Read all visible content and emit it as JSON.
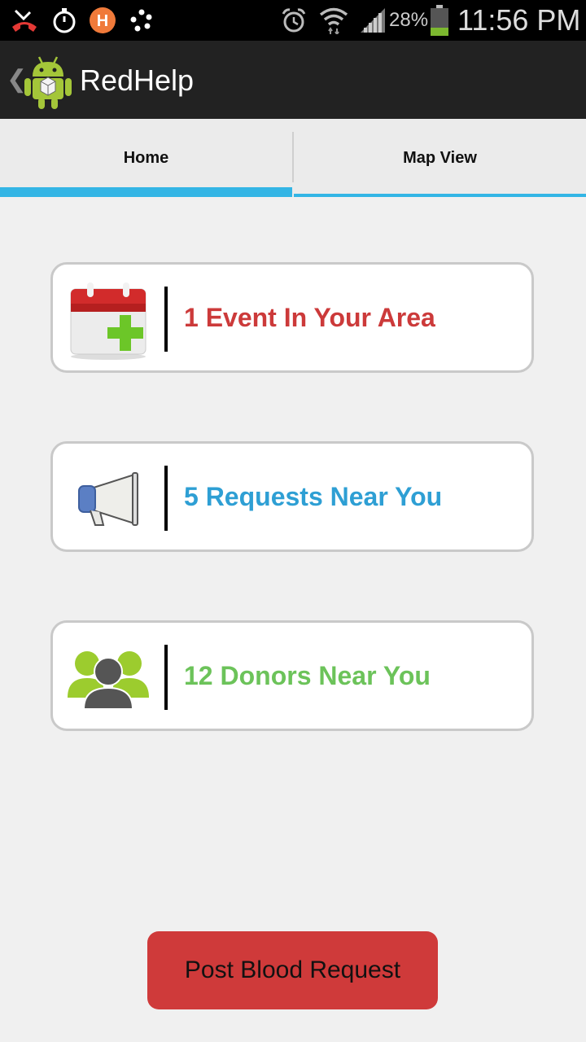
{
  "status_bar": {
    "icons": [
      "missed-call-icon",
      "stopwatch-icon",
      "h-app-icon",
      "dots-app-icon",
      "alarm-icon",
      "wifi-icon",
      "signal-icon",
      "battery-icon"
    ],
    "battery_percent": "28%",
    "time": "11:56 PM"
  },
  "action_bar": {
    "title": "RedHelp",
    "icon": "android-robot-icon"
  },
  "tabs": [
    {
      "label": "Home",
      "active": true
    },
    {
      "label": "Map View",
      "active": false
    }
  ],
  "cards": [
    {
      "icon": "calendar-add-icon",
      "label": "1 Event In Your Area",
      "color": "#cc3a3a"
    },
    {
      "icon": "megaphone-icon",
      "label": "5 Requests Near You",
      "color": "#2e9fd4"
    },
    {
      "icon": "people-icon",
      "label": "12 Donors Near You",
      "color": "#6cc35a"
    }
  ],
  "post_button": {
    "label": "Post Blood Request",
    "color": "#cf3a3a"
  },
  "colors": {
    "tab_indicator": "#33b5e5",
    "action_bar": "#222222"
  }
}
